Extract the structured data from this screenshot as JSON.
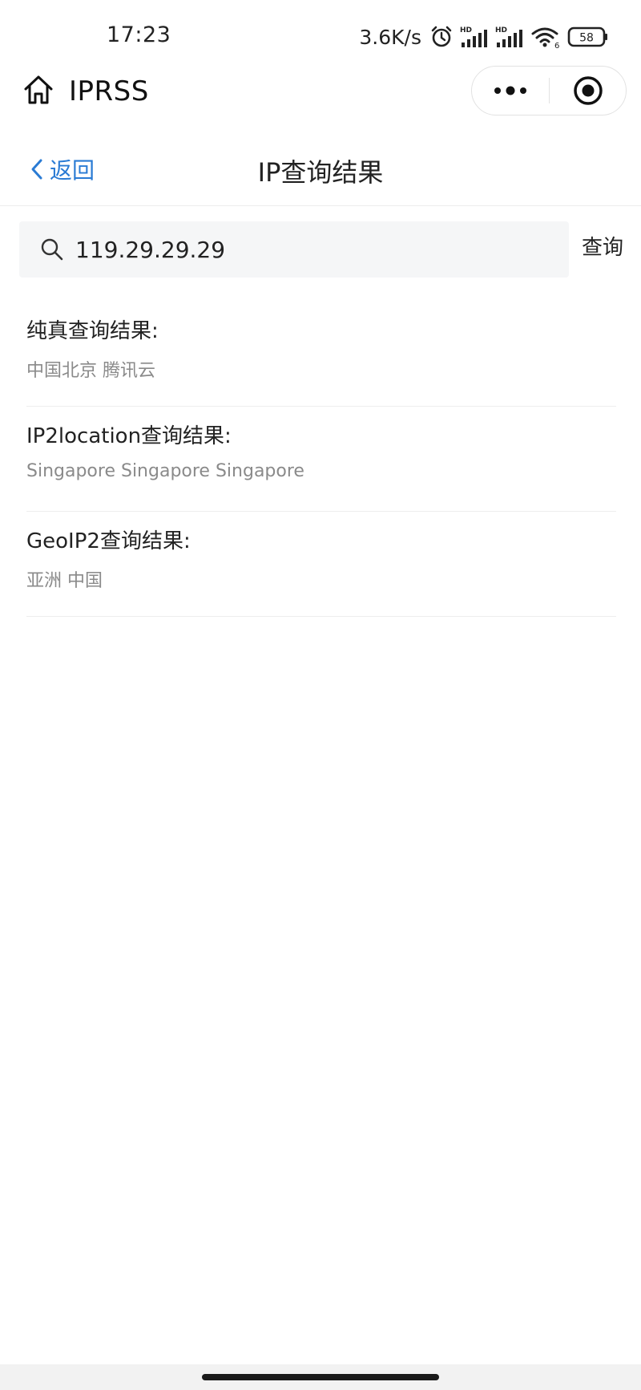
{
  "status_bar": {
    "time": "17:23",
    "net_speed": "3.6K/s",
    "signal_1_label": "HD",
    "signal_2_label": "HD",
    "wifi_label": "6",
    "battery": "58"
  },
  "app": {
    "name": "IPRSS"
  },
  "nav": {
    "back_label": "返回",
    "title": "IP查询结果"
  },
  "search": {
    "value": "119.29.29.29",
    "button_label": "查询"
  },
  "results": [
    {
      "title": "纯真查询结果:",
      "value": "中国北京 腾讯云"
    },
    {
      "title": "IP2location查询结果:",
      "value": "Singapore Singapore Singapore"
    },
    {
      "title": "GeoIP2查询结果:",
      "value": "亚洲 中国"
    }
  ],
  "colors": {
    "accent": "#2a7bd4",
    "secondary_text": "#8a8a8a"
  }
}
